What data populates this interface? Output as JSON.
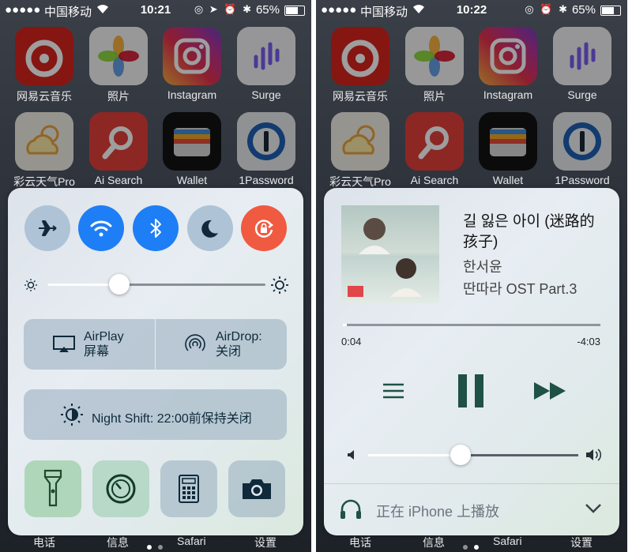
{
  "status_left": {
    "signal": "●●●●●",
    "carrier": "中国移动",
    "time": "10:21",
    "battery": "65%",
    "right_icons": "◎ ➤ ⏰ ✱"
  },
  "status_right": {
    "signal": "●●●●●",
    "carrier": "中国移动",
    "time": "10:22",
    "battery": "65%",
    "right_icons": "◎ ⏰ ✱"
  },
  "apps": [
    {
      "label": "网易云音乐",
      "icon": "netease-music-icon"
    },
    {
      "label": "照片",
      "icon": "photos-icon"
    },
    {
      "label": "Instagram",
      "icon": "instagram-icon"
    },
    {
      "label": "Surge",
      "icon": "surge-icon"
    },
    {
      "label": "彩云天气Pro",
      "icon": "caiyun-weather-icon"
    },
    {
      "label": "Ai Search",
      "icon": "ai-search-icon"
    },
    {
      "label": "Wallet",
      "icon": "wallet-icon"
    },
    {
      "label": "1Password",
      "icon": "1password-icon"
    }
  ],
  "dock": [
    "电话",
    "信息",
    "Safari",
    "设置"
  ],
  "control_center": {
    "toggles": [
      {
        "name": "airplane-mode",
        "state": "off"
      },
      {
        "name": "wifi",
        "state": "on"
      },
      {
        "name": "bluetooth",
        "state": "on"
      },
      {
        "name": "do-not-disturb",
        "state": "off"
      },
      {
        "name": "rotation-lock",
        "state": "on"
      }
    ],
    "brightness": 0.33,
    "airplay_label_1": "AirPlay",
    "airplay_label_2": "屏幕",
    "airdrop_label_1": "AirDrop:",
    "airdrop_label_2": "关闭",
    "night_shift_label": "Night Shift: 22:00前保持关闭",
    "shortcuts": [
      "flashlight-icon",
      "timer-icon",
      "calculator-icon",
      "camera-icon"
    ]
  },
  "now_playing": {
    "title": "길 잃은 아이 (迷路的孩子)",
    "artist": "한서윤",
    "album": "딴따라 OST Part.3",
    "elapsed": "0:04",
    "remaining": "-4:03",
    "progress": 0.016,
    "volume": 0.44,
    "output_label": "正在 iPhone 上播放"
  },
  "colors": {
    "accent_blue": "#1e7ef5",
    "rotation_red": "#f05a41",
    "control_dark": "#1f5146"
  }
}
